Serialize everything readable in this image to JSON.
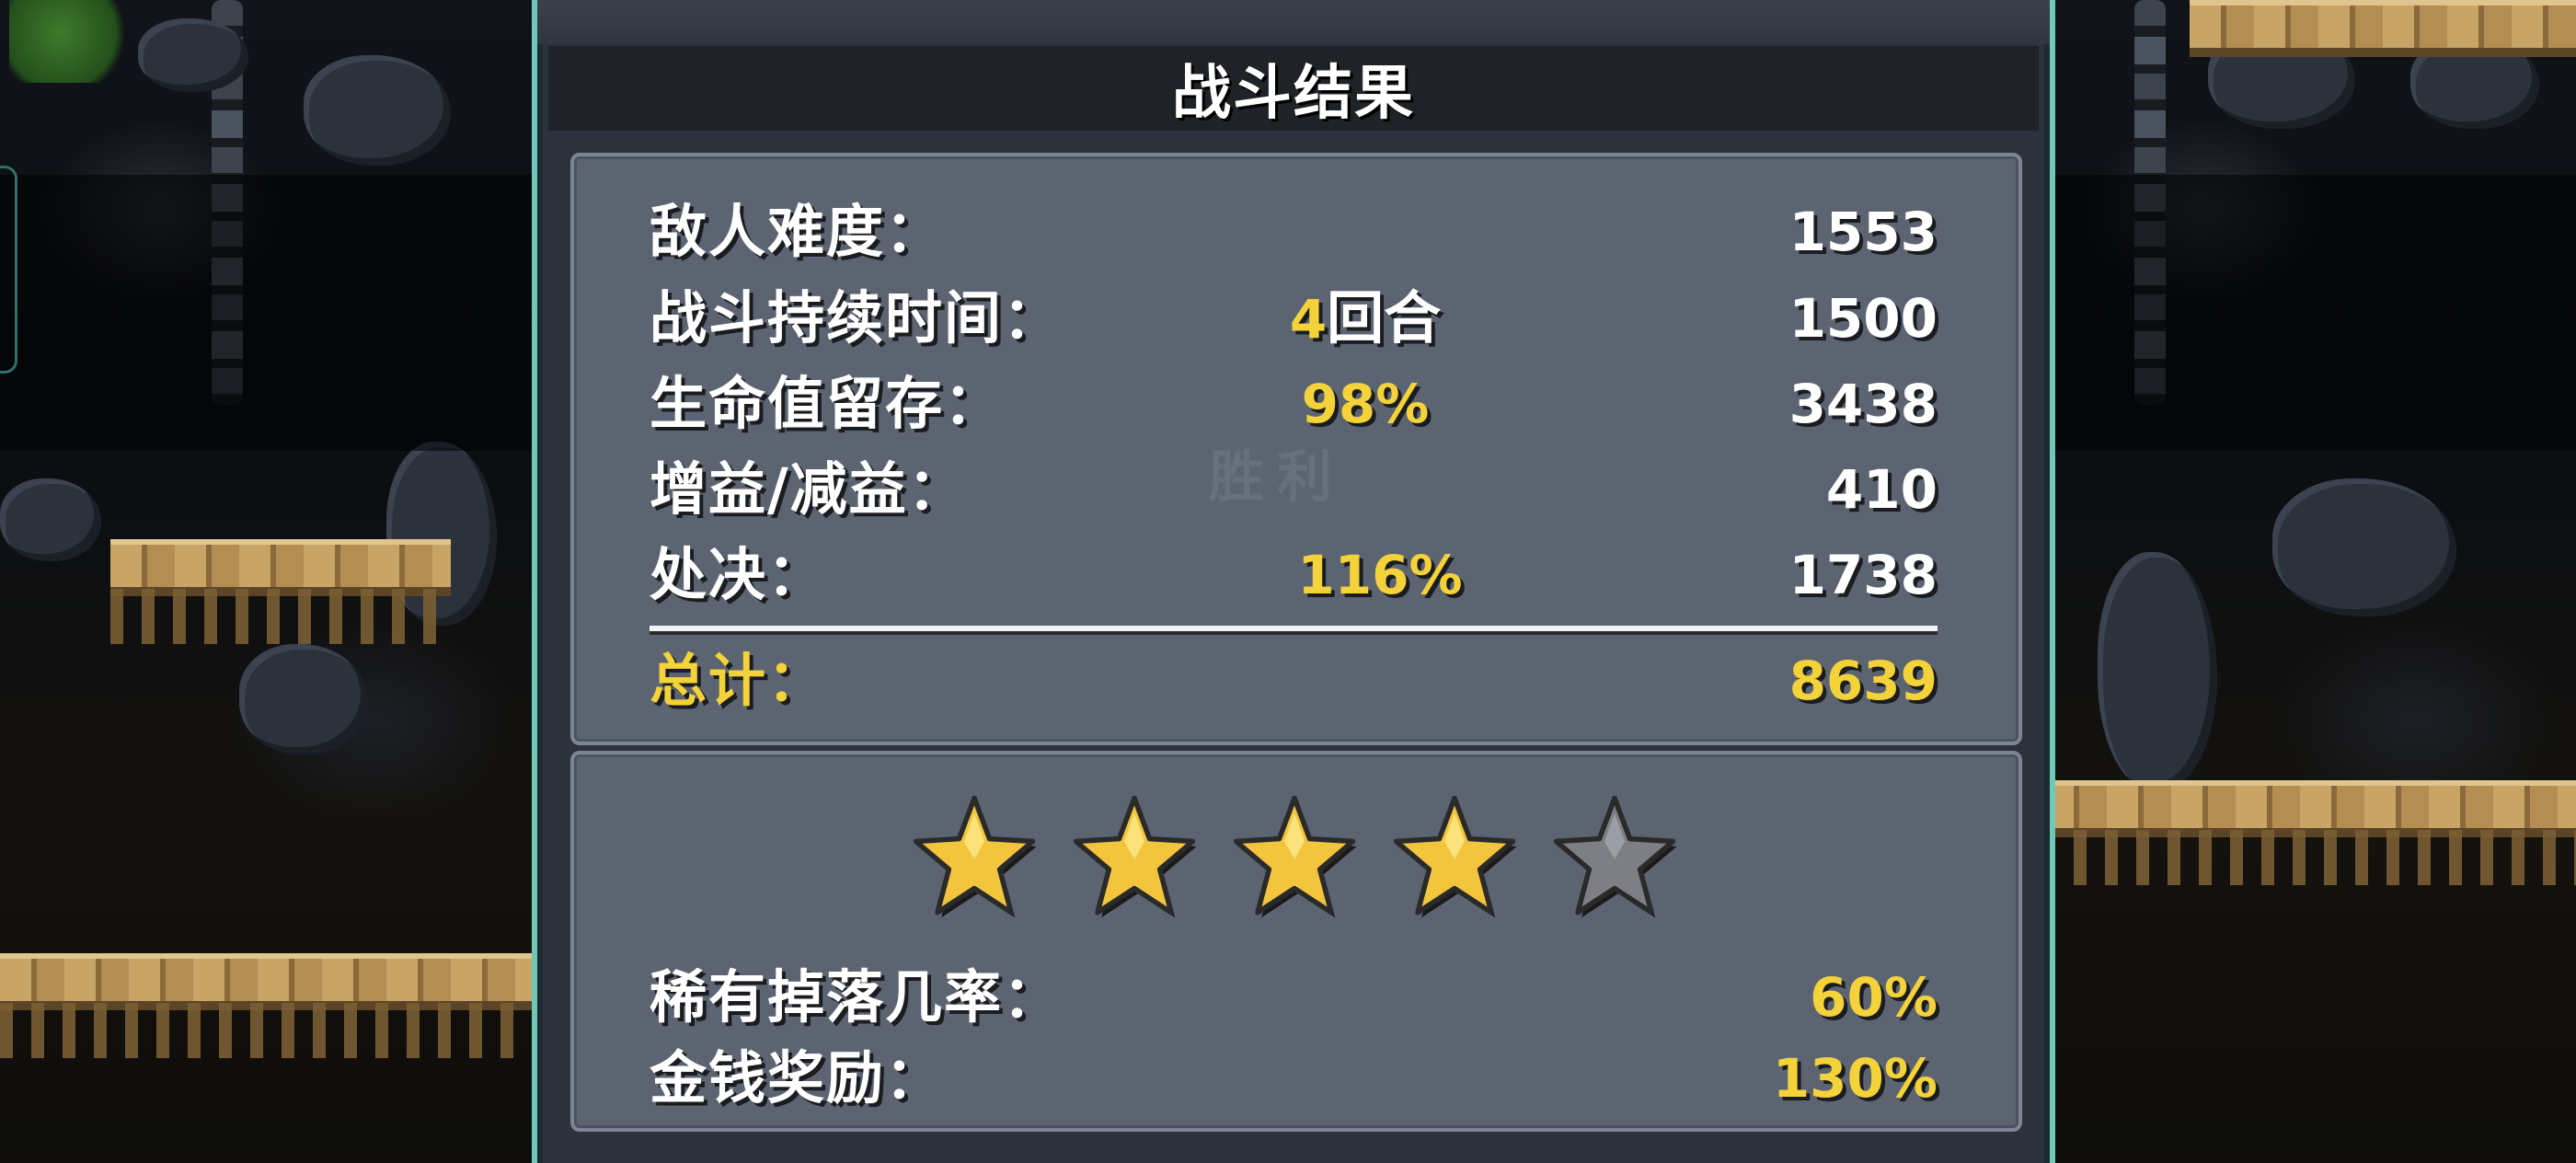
{
  "panel": {
    "title": "战斗结果",
    "faded_text": "胜利"
  },
  "stats": [
    {
      "label": "敌人难度：",
      "mid": "",
      "mid_unit": "",
      "value": "1553"
    },
    {
      "label": "战斗持续时间：",
      "mid": "4",
      "mid_unit": "回合",
      "value": "1500"
    },
    {
      "label": "生命值留存：",
      "mid": "98%",
      "mid_unit": "",
      "value": "3438"
    },
    {
      "label": "增益/减益：",
      "mid": "",
      "mid_unit": "",
      "value": "410"
    },
    {
      "label": "处决：",
      "mid": "116%",
      "mid_unit": "",
      "value": "1738"
    }
  ],
  "total": {
    "label": "总计：",
    "value": "8639"
  },
  "rating": {
    "stars_earned": 4,
    "stars_max": 5,
    "rows": [
      {
        "label": "稀有掉落几率：",
        "value": "60%"
      },
      {
        "label": "金钱奖励：",
        "value": "130%"
      }
    ]
  },
  "colors": {
    "accent_yellow": "#f4d23a",
    "frame_teal": "#6fc9b8",
    "box_gray": "#5c6472",
    "star_gold": "#f2c53d",
    "star_empty": "#7d7f84"
  }
}
